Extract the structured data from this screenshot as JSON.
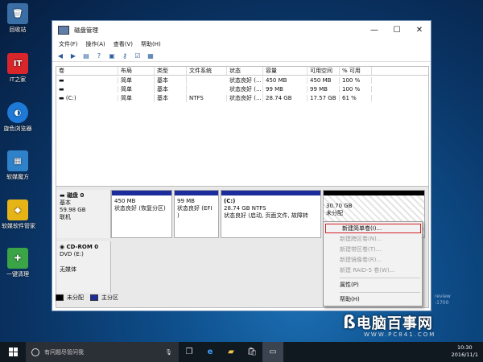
{
  "desktop": {
    "icons": [
      {
        "label": "回收站",
        "glyph": "🗑",
        "color": "#3a6ea5"
      },
      {
        "label": "IT之家",
        "glyph": "IT",
        "color": "#d8262b"
      },
      {
        "label": "旋色浏览器",
        "glyph": "◐",
        "color": "#1e7ad6"
      },
      {
        "label": "软媒魔方",
        "glyph": "▦",
        "color": "#2f82c9"
      },
      {
        "label": "软媒软件管家",
        "glyph": "◆",
        "color": "#e7b417"
      },
      {
        "label": "一键清理",
        "glyph": "✚",
        "color": "#3aa447"
      }
    ]
  },
  "window": {
    "title": "磁盘管理",
    "controls": {
      "minimize": "—",
      "maximize": "☐",
      "close": "✕"
    },
    "menu": [
      "文件(F)",
      "操作(A)",
      "查看(V)",
      "帮助(H)"
    ],
    "toolbar_icons": [
      "back-arrow",
      "forward-arrow",
      "list-view",
      "help",
      "properties",
      "key",
      "checklist",
      "settings"
    ],
    "table": {
      "headers": [
        "卷",
        "布局",
        "类型",
        "文件系统",
        "状态",
        "容量",
        "可用空间",
        "% 可用"
      ],
      "rows": [
        [
          "",
          "简单",
          "基本",
          "",
          "状态良好 (...",
          "450 MB",
          "450 MB",
          "100 %"
        ],
        [
          "",
          "简单",
          "基本",
          "",
          "状态良好 (...",
          "99 MB",
          "99 MB",
          "100 %"
        ],
        [
          "(C:)",
          "简单",
          "基本",
          "NTFS",
          "状态良好 (...",
          "28.74 GB",
          "17.57 GB",
          "61 %"
        ]
      ]
    },
    "disks": [
      {
        "name": "磁盘 0",
        "type": "基本",
        "size": "59.98 GB",
        "status": "联机",
        "partitions": [
          {
            "label": "",
            "size": "450 MB",
            "status": "状态良好 (恢复分区)"
          },
          {
            "label": "",
            "size": "99 MB",
            "status": "状态良好 (EFI )"
          },
          {
            "label": "(C:)",
            "size": "28.74 GB NTFS",
            "status": "状态良好 (启动, 页面文件, 故障转"
          },
          {
            "label": "",
            "size": "30.70 GB",
            "status": "未分配"
          }
        ]
      },
      {
        "name": "CD-ROM 0",
        "type": "DVD (E:)",
        "size": "",
        "status": "无媒体"
      }
    ],
    "legend": [
      {
        "label": "未分配",
        "color": "#000000"
      },
      {
        "label": "主分区",
        "color": "#1b2d9c"
      }
    ]
  },
  "context_menu": {
    "items": [
      "新建简单卷(I)...",
      "新建跨区卷(N)...",
      "新建带区卷(T)...",
      "新建镜像卷(R)...",
      "新建 RAID-5 卷(W)...",
      "属性(P)",
      "帮助(H)"
    ],
    "enabled": [
      true,
      false,
      false,
      false,
      false,
      true,
      true
    ],
    "highlight_color": "#d61e26"
  },
  "taskbar": {
    "search_placeholder": "有问题尽管问我",
    "time": "10:30",
    "date": "2016/11/1"
  },
  "watermark": {
    "brand": "电脑百事网",
    "url": "WWW.PC841.COM",
    "side_lines": [
      "review",
      "-1700"
    ]
  }
}
